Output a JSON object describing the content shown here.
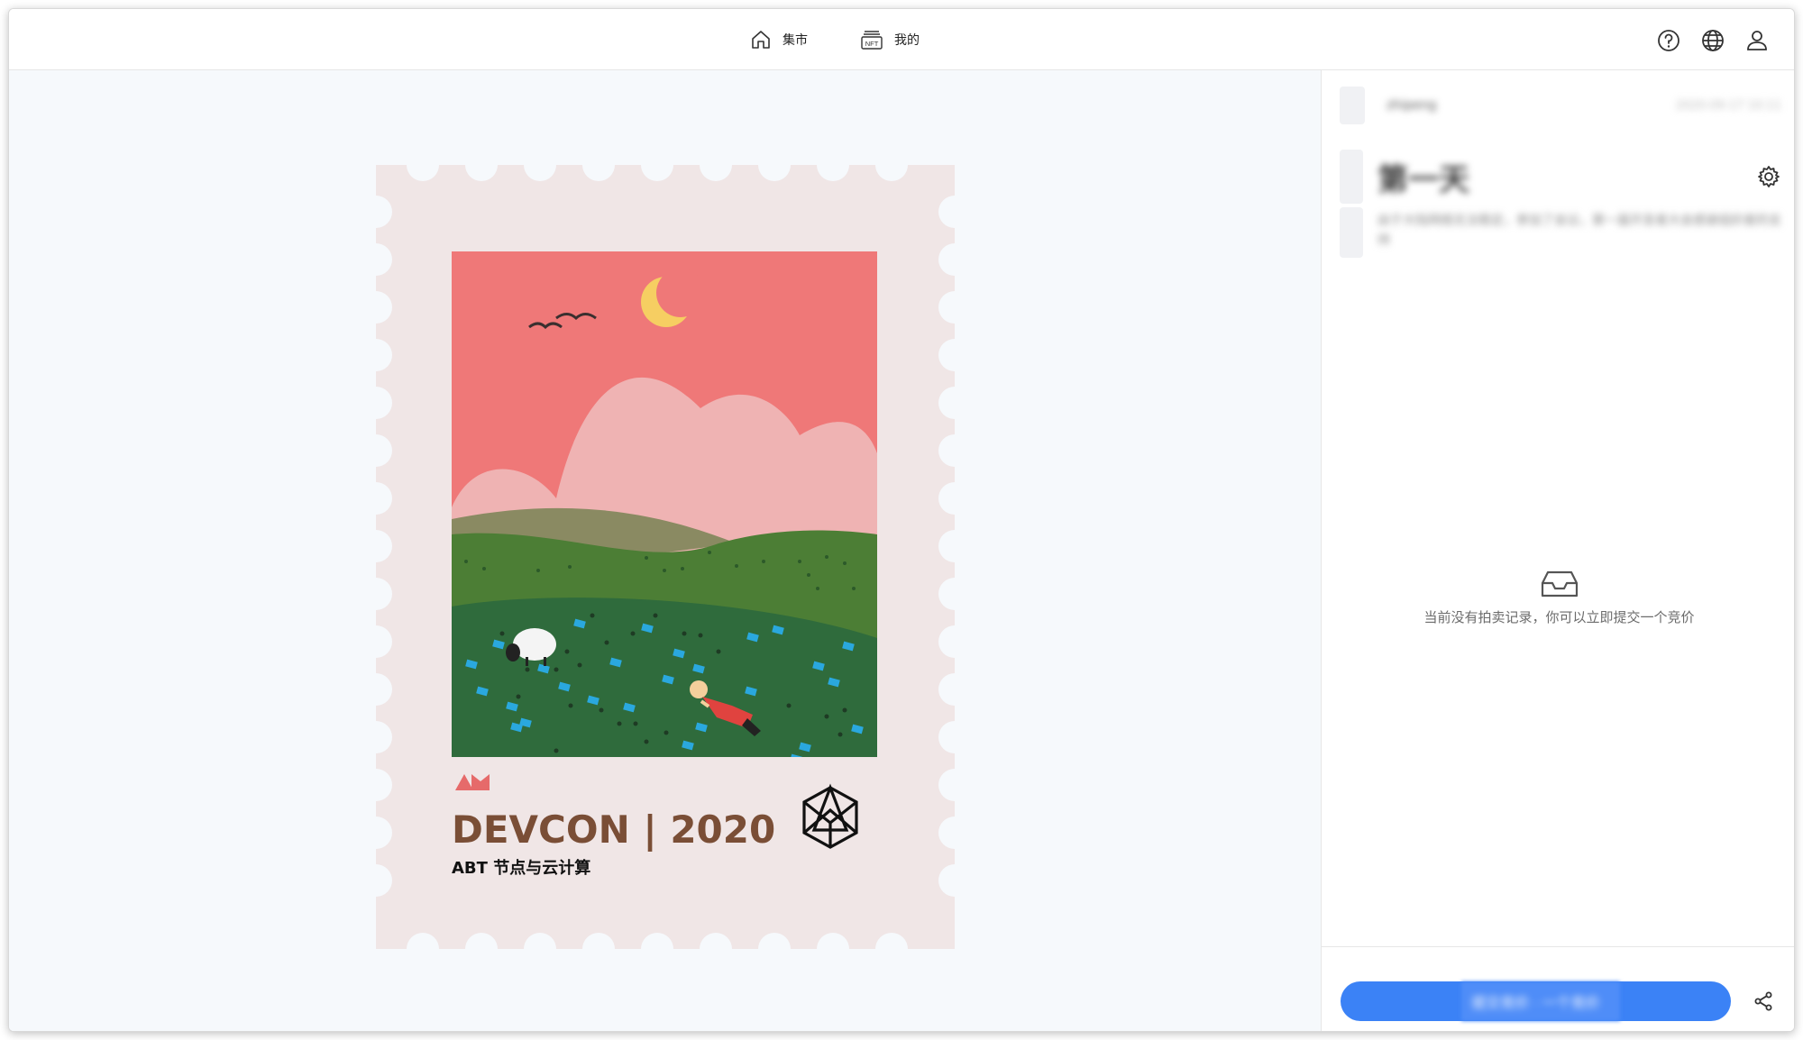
{
  "nav": {
    "market_label": "集市",
    "mine_label": "我的",
    "nft_badge_text": "NFT"
  },
  "icons": {
    "home": "home-icon",
    "mine": "nft-icon",
    "help": "help-icon",
    "language": "globe-icon",
    "account": "user-icon",
    "settings": "gear-icon",
    "empty": "inbox-icon",
    "share": "share-icon"
  },
  "artwork": {
    "brand_mark": "AM",
    "title": "DEVCON | 2020",
    "subtitle": "ABT 节点与云计算"
  },
  "sidebar": {
    "owner_name": "zhipeng",
    "owner_date": "2020-09-17 10:11",
    "nft_title": "第一天",
    "description": "由于大陆网络无法稳定，参加了会议，第一届开发者大会感谢组织者的支持",
    "empty_text": "当前没有拍卖记录，你可以立即提交一个竞价",
    "bid_button_label": "提交竞价 · 一个竞价"
  },
  "colors": {
    "accent": "#3b82f6",
    "title_brown": "#7a4e36",
    "sky_pink": "#ef7878",
    "grass_green": "#2f6b3c"
  }
}
